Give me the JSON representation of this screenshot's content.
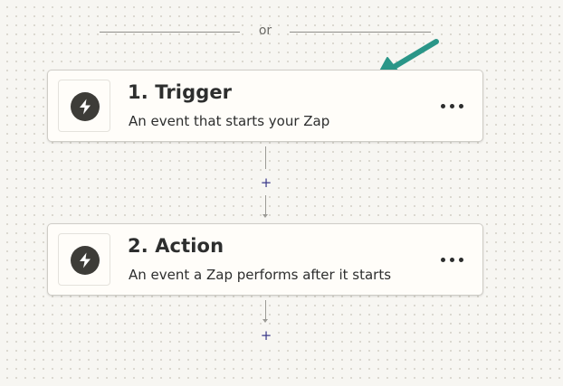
{
  "divider": {
    "text": "or"
  },
  "steps": [
    {
      "title": "1. Trigger",
      "description": "An event that starts your Zap",
      "icon": "lightning-bolt-icon"
    },
    {
      "title": "2. Action",
      "description": "An event a Zap performs after it starts",
      "icon": "lightning-bolt-icon"
    }
  ],
  "add_step_label": "+",
  "colors": {
    "background": "#f7f6f2",
    "card_background": "#fffdf9",
    "card_border": "#cfcdc7",
    "icon_circle": "#3d3c38",
    "text": "#2d2e2e",
    "add_button": "#3b3a8a",
    "annotation_arrow": "#2a9688"
  }
}
